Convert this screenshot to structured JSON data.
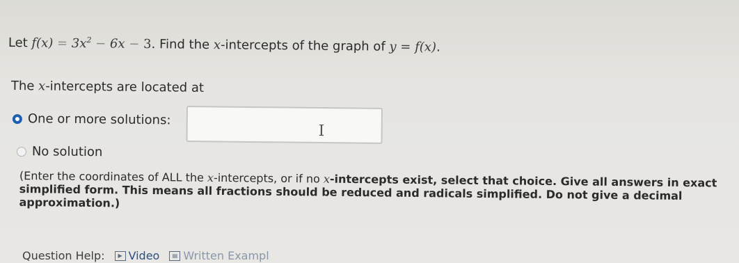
{
  "question": {
    "prefix": "Let ",
    "func_lhs": "f(x)",
    "eq": " = ",
    "t1": "3x",
    "t1_exp": "2",
    "minus1": " − ",
    "t2": "6x",
    "minus2": " − ",
    "t3": "3",
    "middle": ". Find the ",
    "xvar": "x",
    "suffix": "-intercepts of the graph of ",
    "y": "y",
    "eq2": " = ",
    "f_of_x": "f(x)",
    "end": "."
  },
  "intro": {
    "before": "The ",
    "xvar": "x",
    "after": "-intercepts are located at"
  },
  "options": {
    "one_or_more": "One or more solutions:",
    "no_solution": "No solution",
    "selected": "one_or_more"
  },
  "answer_input": {
    "value": "",
    "cursor_glyph": "I"
  },
  "instructions": {
    "p1": "(Enter the coordinates of ALL the ",
    "x1": "x",
    "p2": "-intercepts, or if no ",
    "x2": "x",
    "p3": "-intercepts exist, select that choice. Give all answers in exact simplified form. This means all fractions should be reduced and radicals simplified. Do not give a decimal approximation.)"
  },
  "help": {
    "label": "Question Help:",
    "video": "Video",
    "written": "Written Exampl"
  },
  "colors": {
    "radio_selected": "#1d5fb0"
  },
  "icons": {
    "video": "video-icon",
    "written_example": "document-icon"
  }
}
